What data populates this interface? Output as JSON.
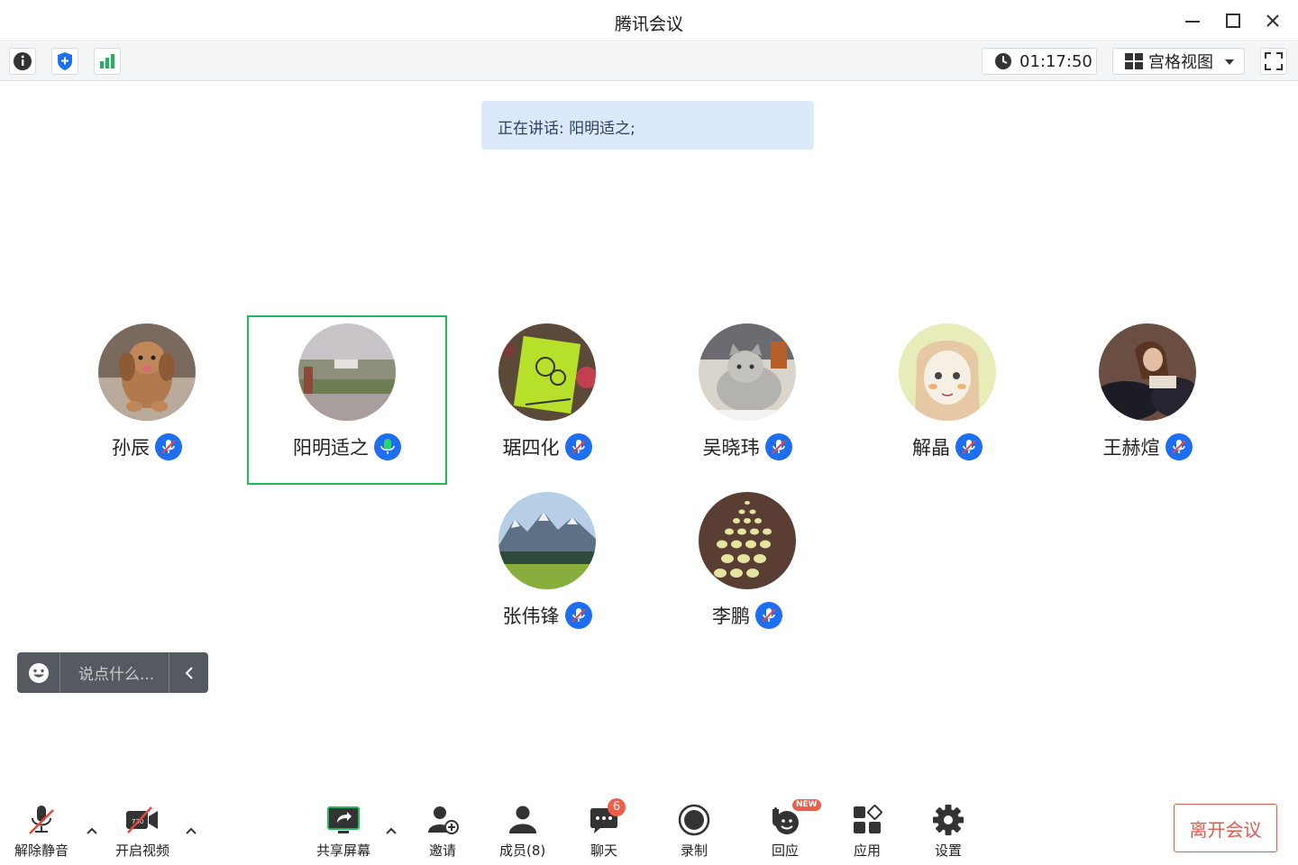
{
  "window": {
    "title": "腾讯会议"
  },
  "toolbar": {
    "timer": "01:17:50",
    "view_mode": "宫格视图"
  },
  "speaking_banner": "正在讲话: 阳明适之;",
  "participants": [
    {
      "name": "孙辰",
      "mic": "muted",
      "active": false
    },
    {
      "name": "阳明适之",
      "mic": "speaking",
      "active": true
    },
    {
      "name": "琚四化",
      "mic": "muted",
      "active": false
    },
    {
      "name": "吴晓玮",
      "mic": "muted",
      "active": false
    },
    {
      "name": "解晶",
      "mic": "muted",
      "active": false
    },
    {
      "name": "王赫煊",
      "mic": "muted",
      "active": false
    },
    {
      "name": "张伟锋",
      "mic": "muted",
      "active": false
    },
    {
      "name": "李鹏",
      "mic": "muted",
      "active": false
    }
  ],
  "chat_input": {
    "placeholder": "说点什么..."
  },
  "bottom": {
    "unmute": "解除静音",
    "start_video": "开启视频",
    "share_screen": "共享屏幕",
    "invite": "邀请",
    "members": "成员(8)",
    "chat": "聊天",
    "chat_badge": "6",
    "record": "录制",
    "react": "回应",
    "react_tag": "NEW",
    "apps": "应用",
    "settings": "设置",
    "leave": "离开会议"
  },
  "colors": {
    "active_border": "#21b95e",
    "mic_blue": "#1d6ef0",
    "leave_red": "#e05b4e",
    "banner_bg": "#dce9fb"
  }
}
